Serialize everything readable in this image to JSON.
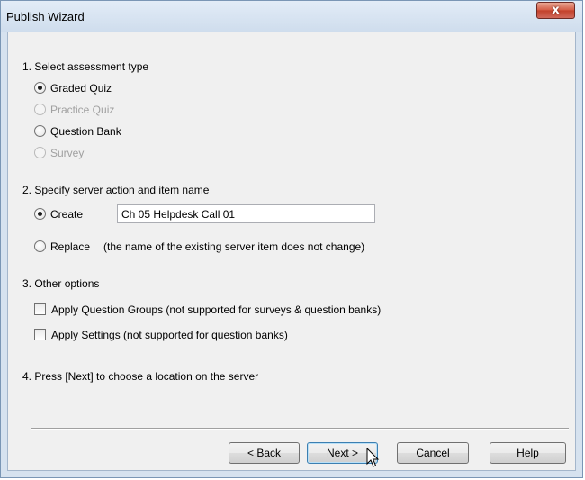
{
  "window": {
    "title": "Publish Wizard",
    "close_glyph": "x"
  },
  "step1": {
    "heading": "1.  Select assessment type",
    "options": [
      {
        "label": "Graded Quiz",
        "selected": true,
        "enabled": true
      },
      {
        "label": "Practice Quiz",
        "selected": false,
        "enabled": false
      },
      {
        "label": "Question Bank",
        "selected": false,
        "enabled": true
      },
      {
        "label": "Survey",
        "selected": false,
        "enabled": false
      }
    ]
  },
  "step2": {
    "heading": "2.  Specify server action and item name",
    "create_label": "Create",
    "create_selected": true,
    "item_name_value": "Ch 05 Helpdesk Call 01",
    "replace_label": "Replace",
    "replace_note": "(the name of the existing server item does not change)"
  },
  "step3": {
    "heading": "3.  Other options",
    "apply_groups_label": "Apply Question Groups (not supported for surveys & question banks)",
    "apply_groups_checked": false,
    "apply_settings_label": "Apply Settings (not supported for question banks)",
    "apply_settings_checked": false
  },
  "step4": {
    "heading": "4.  Press [Next] to choose a location on the server"
  },
  "buttons": {
    "back": "< Back",
    "next": "Next >",
    "cancel": "Cancel",
    "help": "Help"
  },
  "icons": {
    "close": "close-icon",
    "pointer": "mouse-pointer-icon"
  }
}
